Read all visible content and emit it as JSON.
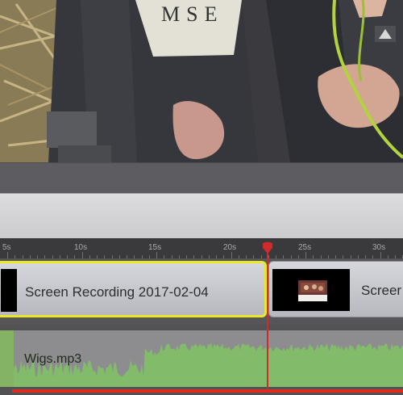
{
  "ruler": {
    "labels": [
      "5s",
      "10s",
      "15s",
      "20s",
      "25s",
      "30s"
    ]
  },
  "video_track": {
    "clips": [
      {
        "title": "Screen Recording 2017-02-04",
        "selected": true
      },
      {
        "title": "Screer",
        "selected": false
      }
    ]
  },
  "audio_track": {
    "title": "Wigs.mp3"
  },
  "colors": {
    "selection": "#e9e826",
    "playhead": "#d12a2a",
    "waveform": "#82bb6a"
  }
}
